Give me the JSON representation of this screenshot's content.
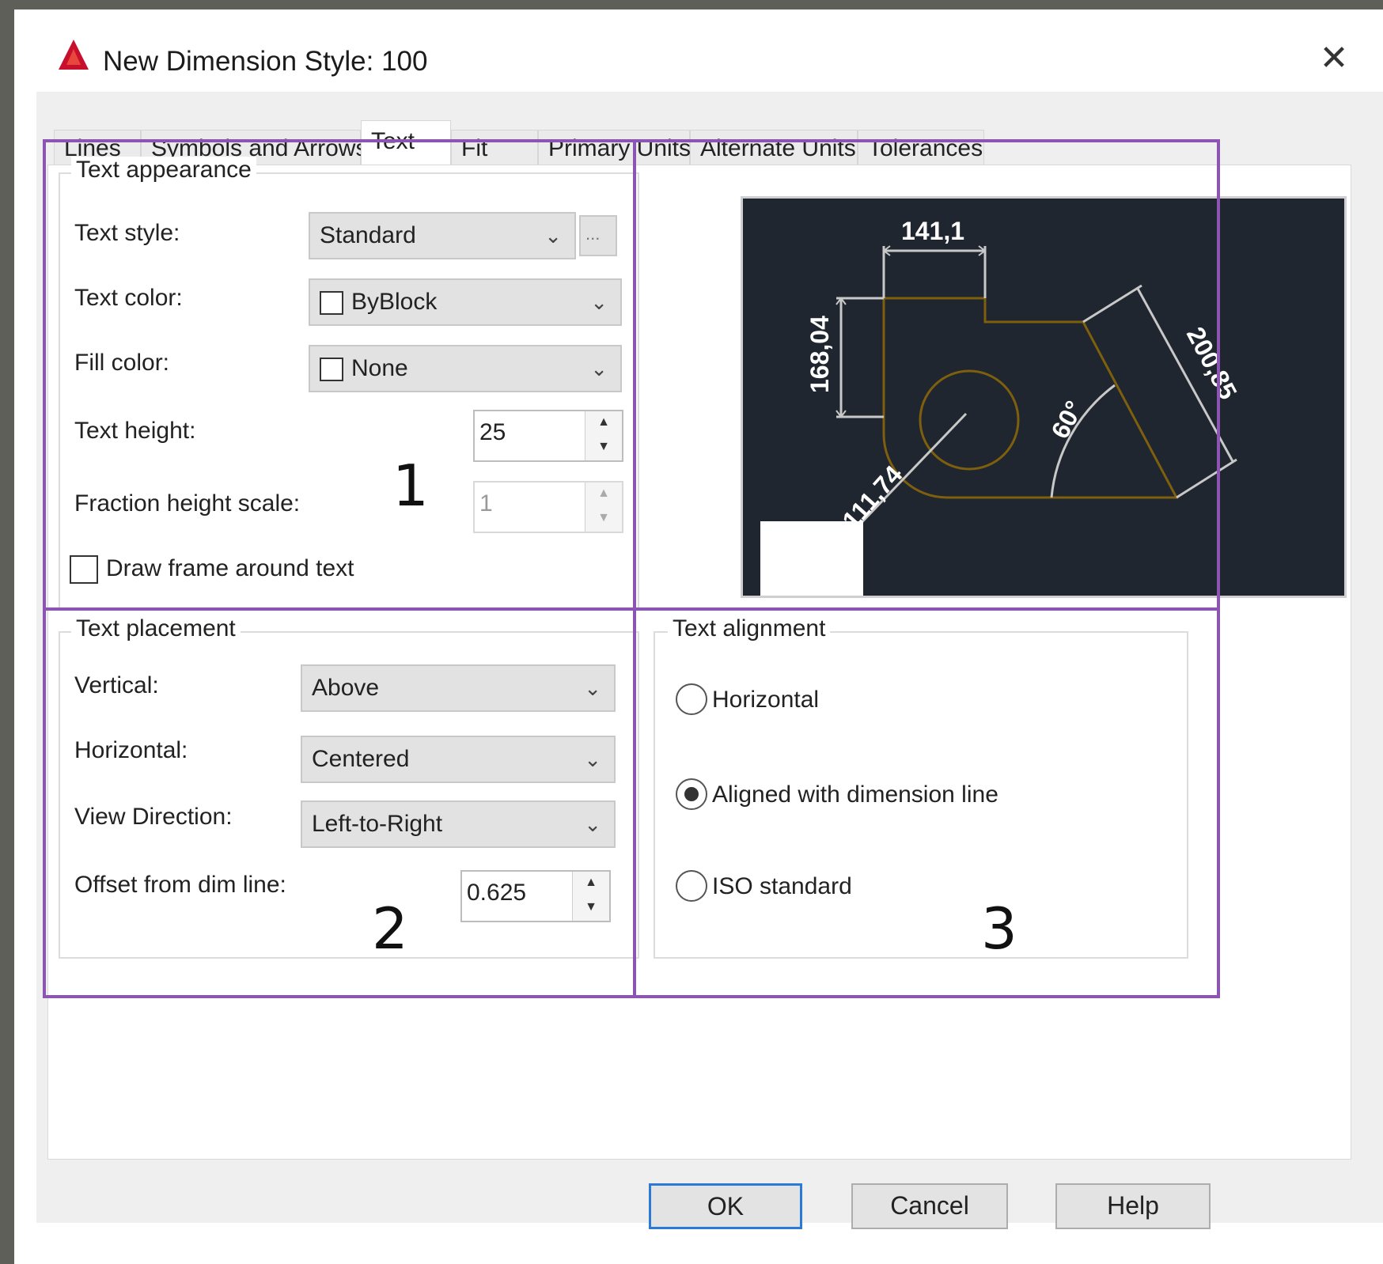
{
  "window": {
    "title": "New Dimension Style: 100",
    "close_glyph": "✕",
    "icon": "autocad-logo-icon"
  },
  "tabs": [
    {
      "label": "Lines"
    },
    {
      "label": "Symbols and Arrows"
    },
    {
      "label": "Text",
      "active": true
    },
    {
      "label": "Fit"
    },
    {
      "label": "Primary Units"
    },
    {
      "label": "Alternate Units"
    },
    {
      "label": "Tolerances"
    }
  ],
  "text_appearance": {
    "legend": "Text appearance",
    "text_style_label": "Text style:",
    "text_style_value": "Standard",
    "browse_glyph": "...",
    "text_color_label": "Text color:",
    "text_color_value": "ByBlock",
    "fill_color_label": "Fill color:",
    "fill_color_value": "None",
    "text_height_label": "Text height:",
    "text_height_value": "25",
    "fraction_height_label": "Fraction height scale:",
    "fraction_height_value": "1",
    "draw_frame_label": "Draw frame around text",
    "draw_frame_checked": false
  },
  "text_placement": {
    "legend": "Text placement",
    "vertical_label": "Vertical:",
    "vertical_value": "Above",
    "horizontal_label": "Horizontal:",
    "horizontal_value": "Centered",
    "view_direction_label": "View Direction:",
    "view_direction_value": "Left-to-Right",
    "offset_label": "Offset from dim line:",
    "offset_value": "0.625"
  },
  "text_alignment": {
    "legend": "Text alignment",
    "options": [
      {
        "label": "Horizontal",
        "checked": false
      },
      {
        "label": "Aligned with dimension line",
        "checked": true
      },
      {
        "label": "ISO standard",
        "checked": false
      }
    ]
  },
  "preview": {
    "dim_top": "141,1",
    "dim_left": "168,04",
    "dim_right": "200,85",
    "dim_angle": "60°",
    "dim_radius": "111,74",
    "geometry_color": "#7d5f0d",
    "dim_color": "#c8c8c8",
    "background": "#1f262f"
  },
  "annotations": {
    "region_1": "1",
    "region_2": "2",
    "region_3": "3",
    "highlight_color": "#8c55b4"
  },
  "buttons": {
    "ok": "OK",
    "cancel": "Cancel",
    "help": "Help"
  }
}
